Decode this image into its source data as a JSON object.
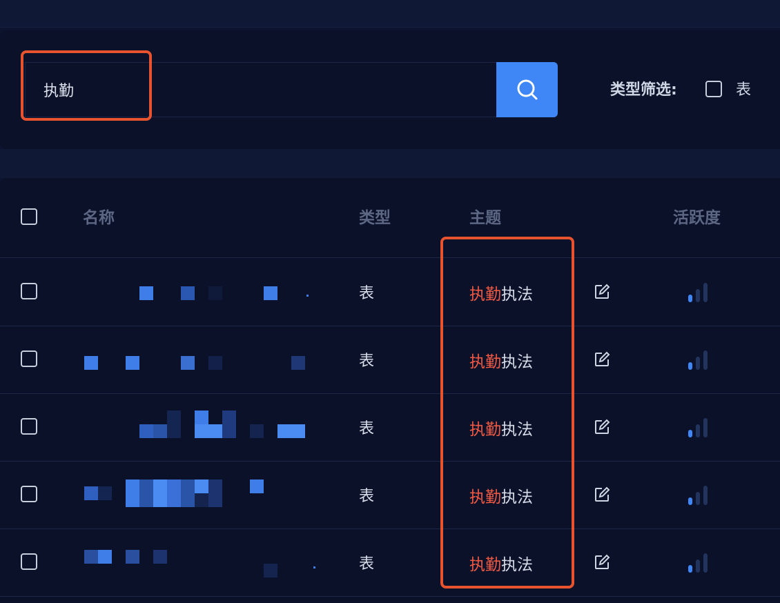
{
  "search": {
    "value": "执勤",
    "placeholder": ""
  },
  "filter": {
    "label": "类型筛选:",
    "options": [
      {
        "label": "表",
        "checked": false
      }
    ]
  },
  "table": {
    "columns": {
      "name": "名称",
      "type": "类型",
      "topic": "主题",
      "activity": "活跃度"
    },
    "rows": [
      {
        "name": "",
        "type": "表",
        "topic_match": "执勤",
        "topic_rest": "执法",
        "activity_level": 1
      },
      {
        "name": "",
        "type": "表",
        "topic_match": "执勤",
        "topic_rest": "执法",
        "activity_level": 1
      },
      {
        "name": "",
        "type": "表",
        "topic_match": "执勤",
        "topic_rest": "执法",
        "activity_level": 1
      },
      {
        "name": "",
        "type": "表",
        "topic_match": "执勤",
        "topic_rest": "执法",
        "activity_level": 1
      },
      {
        "name": "",
        "type": "表",
        "topic_match": "执勤",
        "topic_rest": "执法",
        "activity_level": 1
      }
    ]
  },
  "colors": {
    "accent": "#3f86f6",
    "highlight_text": "#f05a45",
    "annotation_box": "#e8532f",
    "background": "#0a1129"
  },
  "icons": {
    "search_button": "search-icon",
    "row_edit": "edit-icon",
    "row_activity": "signal-bars-icon"
  }
}
